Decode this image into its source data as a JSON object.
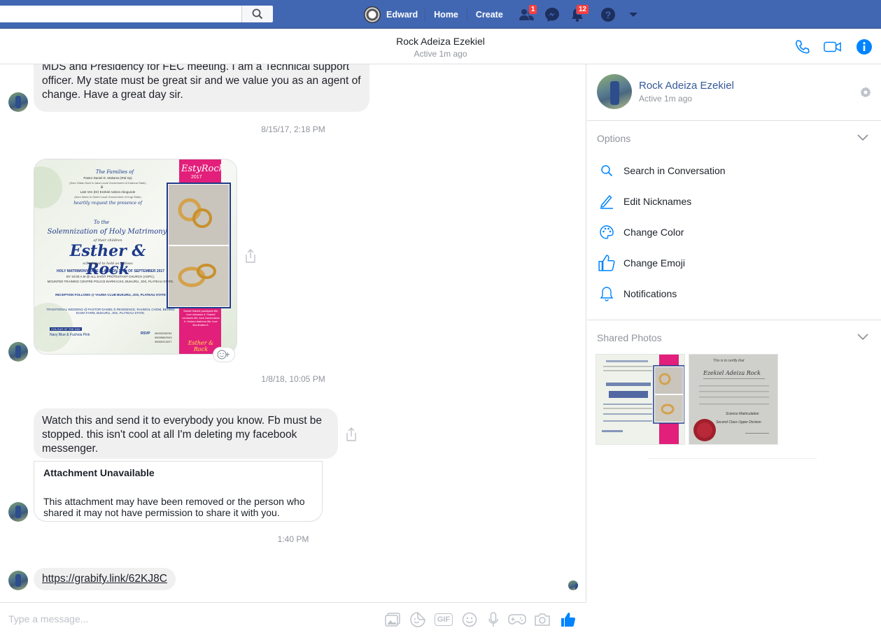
{
  "topbar": {
    "search_placeholder": "",
    "user_name": "Edward",
    "home": "Home",
    "create": "Create",
    "friend_requests_count": "1",
    "notifications_count": "12"
  },
  "conversation": {
    "name": "Rock Adeiza Ezekiel",
    "status": "Active 1m ago"
  },
  "messages": {
    "msg1_text": "MDS and Presidency for FEC meeting. I am a Technical support officer. My state must be great sir and we value you as an agent of change. Have a great day sir.",
    "ts1": "8/15/17, 2:18 PM",
    "invitation": {
      "families": "The Families of",
      "line1": "Pastor Daniel D. Makama (Rtd Sp)",
      "line2": "(from Gidan-Sani in Jaba Local Government of Kaduna State)",
      "and": "&",
      "line3": "Late Ven (Dr) Ezekiel Adeiza Abogunde",
      "line4": "(from Ihima In Okehi Local Government of Kogi State)",
      "request": "heartily request the presence of",
      "to_the": "To the",
      "solemn": "Solemnization of Holy Matrimony",
      "children": "of their children",
      "couple": "Esther & Rock",
      "scheduled": "scheduled to hold as follows",
      "holy": "HOLY MATRIMONY TAKE PLACE ON 30TH OF SEPTEMBER 2017",
      "holy2": "BY 10:00 A.M @ ALL SAINT PROTESTANT CHURCH (ASPC),",
      "holy3": "MOUNTED TRAINING CENTRE POLICE BARRACKS, BUKURU, JOS, PLATEAU STATE.",
      "reception": "RECEPTION FOLLOWS @ YAUWA CLUB BUKURU, JOS, PLATEAU STATE",
      "trad": "TRADITIONAL WEDDING @ PASTOR DANIEL'S RESIDENCE, RAHWOL CHOM, BEHIND ECWA FARM, BUKURU, JOS, PLATEAU STATE.",
      "colour_label": "COLOUR OF THE DAY",
      "colours": "Navy Blue & Fuchsia Pink",
      "rsvp": "RSVP",
      "phones": "08032058764 08035862943 08069313227",
      "brand": "EstyRock",
      "year": "2017",
      "sidebar_text": "Sweet Hatred paralyses life; love releases it. Hatred confuses life; love harmonizes it. Hatred darkens life; love illuminates it.",
      "sign": "Esther & Rock"
    },
    "ts2": "1/8/18, 10:05 PM",
    "msg3_text": "Watch this and send it to everybody you know. Fb must be stopped. this isn't cool at all I'm deleting my facebook messenger.",
    "attachment_title": "Attachment Unavailable",
    "attachment_text": "This attachment may have been removed or the person who shared it may not have permission to share it with you.",
    "ts3": "1:40 PM",
    "link": "https://grabify.link/62KJ8C"
  },
  "composer": {
    "placeholder": "Type a message...",
    "gif": "GIF"
  },
  "panel": {
    "name": "Rock Adeiza Ezekiel",
    "status": "Active 1m ago",
    "options_title": "Options",
    "options": [
      {
        "label": "Search in Conversation",
        "icon": "search-icon"
      },
      {
        "label": "Edit Nicknames",
        "icon": "pencil-icon"
      },
      {
        "label": "Change Color",
        "icon": "palette-icon"
      },
      {
        "label": "Change Emoji",
        "icon": "thumbs-up-icon"
      },
      {
        "label": "Notifications",
        "icon": "bell-icon"
      }
    ],
    "shared_title": "Shared Photos",
    "certificate": {
      "line1": "This is to certify that",
      "name": "Ezekiel Adeiza Rock",
      "field": "Science Matriculation",
      "division": "Second Class Upper Division"
    }
  },
  "colors": {
    "brand_blue": "#4267b2",
    "messenger_blue": "#0084ff",
    "bubble_gray": "#f1f0f0",
    "fuchsia": "#e21f7a",
    "navy": "#1e3a8a"
  }
}
